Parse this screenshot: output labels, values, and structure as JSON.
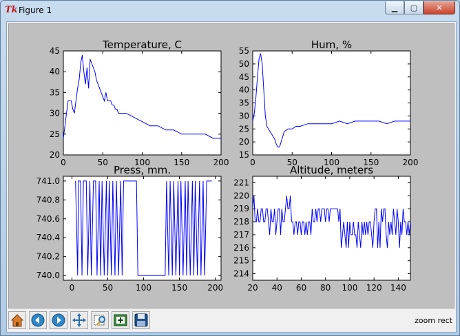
{
  "window": {
    "title": "Figure 1",
    "minimize_icon": "minimize-icon",
    "maximize_icon": "maximize-icon",
    "close_icon": "close-icon"
  },
  "status": {
    "text": "zoom rect"
  },
  "toolbar": {
    "buttons": [
      "home-icon",
      "back-icon",
      "forward-icon",
      "pan-icon",
      "zoom-icon",
      "subplots-icon",
      "save-icon"
    ]
  },
  "colors": {
    "figure_bg": "#bfbfbf",
    "line": "#0000ff"
  },
  "chart_data": [
    {
      "type": "line",
      "title": "Temperature, C",
      "xlim": [
        0,
        200
      ],
      "ylim": [
        20,
        45
      ],
      "xticks": [
        "0",
        "50",
        "100",
        "150",
        "200"
      ],
      "yticks": [
        "20",
        "25",
        "30",
        "35",
        "40",
        "45"
      ],
      "series": [
        {
          "x": [
            0,
            2,
            4,
            6,
            8,
            10,
            12,
            14,
            16,
            18,
            20,
            22,
            24,
            26,
            28,
            30,
            32,
            34,
            36,
            38,
            40,
            42,
            44,
            46,
            48,
            50,
            52,
            54,
            56,
            58,
            60,
            62,
            64,
            66,
            68,
            70,
            72,
            74,
            76,
            78,
            80,
            90,
            100,
            110,
            120,
            130,
            140,
            150,
            160,
            170,
            180,
            190,
            200
          ],
          "y": [
            24,
            27,
            30,
            33,
            33,
            33,
            31,
            30,
            33,
            36,
            38,
            42,
            44,
            40,
            37,
            41,
            36,
            43,
            42,
            41,
            40,
            38,
            37,
            36,
            35,
            34,
            33,
            35,
            33,
            33,
            33,
            32,
            32,
            31,
            31,
            30,
            30,
            30,
            30,
            30,
            30,
            29,
            28,
            27,
            27,
            26,
            26,
            25,
            25,
            25,
            25,
            24,
            24
          ]
        }
      ]
    },
    {
      "type": "line",
      "title": "Hum, %",
      "xlim": [
        0,
        200
      ],
      "ylim": [
        15,
        55
      ],
      "xticks": [
        "0",
        "50",
        "100",
        "150",
        "200"
      ],
      "yticks": [
        "15",
        "20",
        "25",
        "30",
        "35",
        "40",
        "45",
        "50",
        "55"
      ],
      "series": [
        {
          "x": [
            0,
            2,
            4,
            6,
            8,
            10,
            12,
            14,
            16,
            18,
            20,
            22,
            24,
            26,
            28,
            30,
            32,
            34,
            36,
            38,
            40,
            45,
            50,
            55,
            60,
            70,
            80,
            90,
            100,
            110,
            120,
            130,
            140,
            150,
            160,
            170,
            180,
            190,
            200
          ],
          "y": [
            28,
            31,
            37,
            45,
            52,
            54,
            50,
            40,
            30,
            26,
            25,
            24,
            23,
            22,
            21,
            19,
            18,
            18,
            20,
            22,
            24,
            25,
            25,
            26,
            26,
            27,
            27,
            27,
            27,
            28,
            27,
            28,
            28,
            28,
            28,
            27,
            28,
            28,
            28
          ]
        }
      ]
    },
    {
      "type": "line",
      "title": "Press, mm.",
      "xlim": [
        -12,
        208
      ],
      "ylim": [
        739.95,
        741.05
      ],
      "xticks": [
        "0",
        "50",
        "100",
        "150",
        "200"
      ],
      "yticks": [
        "740.0",
        "740.2",
        "740.4",
        "740.6",
        "740.8",
        "741.0"
      ],
      "series": [
        {
          "x": [
            5,
            8,
            9,
            12,
            14,
            16,
            17,
            20,
            22,
            25,
            27,
            30,
            33,
            35,
            38,
            40,
            42,
            45,
            48,
            50,
            52,
            55,
            57,
            60,
            62,
            65,
            68,
            70,
            72,
            75,
            80,
            90,
            92,
            95,
            100,
            110,
            120,
            130,
            132,
            135,
            137,
            140,
            142,
            145,
            148,
            150,
            152,
            155,
            158,
            160,
            162,
            165,
            168,
            170,
            172,
            175,
            178,
            180,
            183,
            185,
            188,
            190,
            195
          ],
          "y": [
            741.0,
            740.0,
            741.0,
            741.0,
            740.0,
            741.0,
            741.0,
            741.0,
            740.0,
            741.0,
            740.0,
            741.0,
            741.0,
            740.0,
            741.0,
            740.0,
            741.0,
            740.0,
            741.0,
            740.0,
            741.0,
            740.0,
            741.0,
            740.0,
            741.0,
            740.0,
            741.0,
            740.0,
            741.0,
            741.0,
            741.0,
            741.0,
            740.0,
            740.0,
            740.0,
            740.0,
            740.0,
            740.0,
            741.0,
            740.0,
            741.0,
            740.0,
            741.0,
            740.0,
            741.0,
            740.0,
            741.0,
            740.0,
            741.0,
            740.0,
            741.0,
            740.0,
            741.0,
            740.0,
            741.0,
            740.0,
            741.0,
            740.0,
            741.0,
            740.0,
            741.0,
            741.0,
            741.0
          ]
        }
      ]
    },
    {
      "type": "line",
      "title": "Altitude, meters",
      "xlim": [
        20,
        150
      ],
      "ylim": [
        213.5,
        221.5
      ],
      "xticks": [
        "20",
        "40",
        "60",
        "80",
        "100",
        "120",
        "140"
      ],
      "yticks": [
        "214",
        "215",
        "216",
        "217",
        "218",
        "219",
        "220",
        "221"
      ],
      "series": [
        {
          "x": [
            20,
            21,
            22,
            23,
            24,
            25,
            26,
            27,
            28,
            29,
            30,
            31,
            32,
            33,
            34,
            35,
            36,
            37,
            38,
            39,
            40,
            41,
            42,
            43,
            44,
            45,
            46,
            47,
            48,
            49,
            50,
            51,
            52,
            53,
            54,
            55,
            56,
            57,
            58,
            59,
            60,
            61,
            62,
            63,
            64,
            65,
            66,
            67,
            68,
            69,
            70,
            71,
            72,
            73,
            74,
            75,
            76,
            77,
            78,
            79,
            80,
            81,
            82,
            83,
            84,
            85,
            86,
            87,
            88,
            89,
            90,
            91,
            92,
            93,
            94,
            95,
            96,
            97,
            98,
            99,
            100,
            101,
            102,
            103,
            104,
            105,
            106,
            107,
            108,
            109,
            110,
            111,
            112,
            113,
            114,
            115,
            116,
            117,
            118,
            119,
            120,
            121,
            122,
            123,
            124,
            125,
            126,
            127,
            128,
            129,
            130,
            131,
            132,
            133,
            134,
            135,
            136,
            137,
            138,
            139,
            140,
            141,
            142,
            143,
            144,
            145,
            146,
            147,
            148,
            149,
            150
          ],
          "y": [
            219,
            220,
            218,
            218,
            219,
            218,
            218,
            219,
            219,
            218,
            218,
            219,
            219,
            218,
            217,
            219,
            218,
            218,
            219,
            217,
            218,
            219,
            219,
            217,
            219,
            218,
            218,
            219,
            220,
            219,
            219,
            220,
            218,
            218,
            217,
            218,
            218,
            217,
            218,
            218,
            217,
            218,
            218,
            217,
            218,
            217,
            218,
            218,
            217,
            219,
            218,
            218,
            219,
            218,
            219,
            219,
            218,
            219,
            219,
            219,
            218,
            219,
            219,
            218,
            219,
            219,
            219,
            219,
            219,
            219,
            219,
            218,
            219,
            216,
            217,
            218,
            217,
            216,
            218,
            216,
            218,
            217,
            217,
            218,
            217,
            217,
            216,
            218,
            217,
            216,
            218,
            217,
            218,
            217,
            218,
            217,
            218,
            218,
            217,
            216,
            218,
            219,
            219,
            216,
            218,
            216,
            219,
            218,
            219,
            219,
            217,
            216,
            218,
            217,
            218,
            217,
            219,
            218,
            217,
            219,
            218,
            216,
            218,
            217,
            219,
            218,
            218,
            217,
            218,
            217,
            218
          ]
        }
      ]
    }
  ]
}
